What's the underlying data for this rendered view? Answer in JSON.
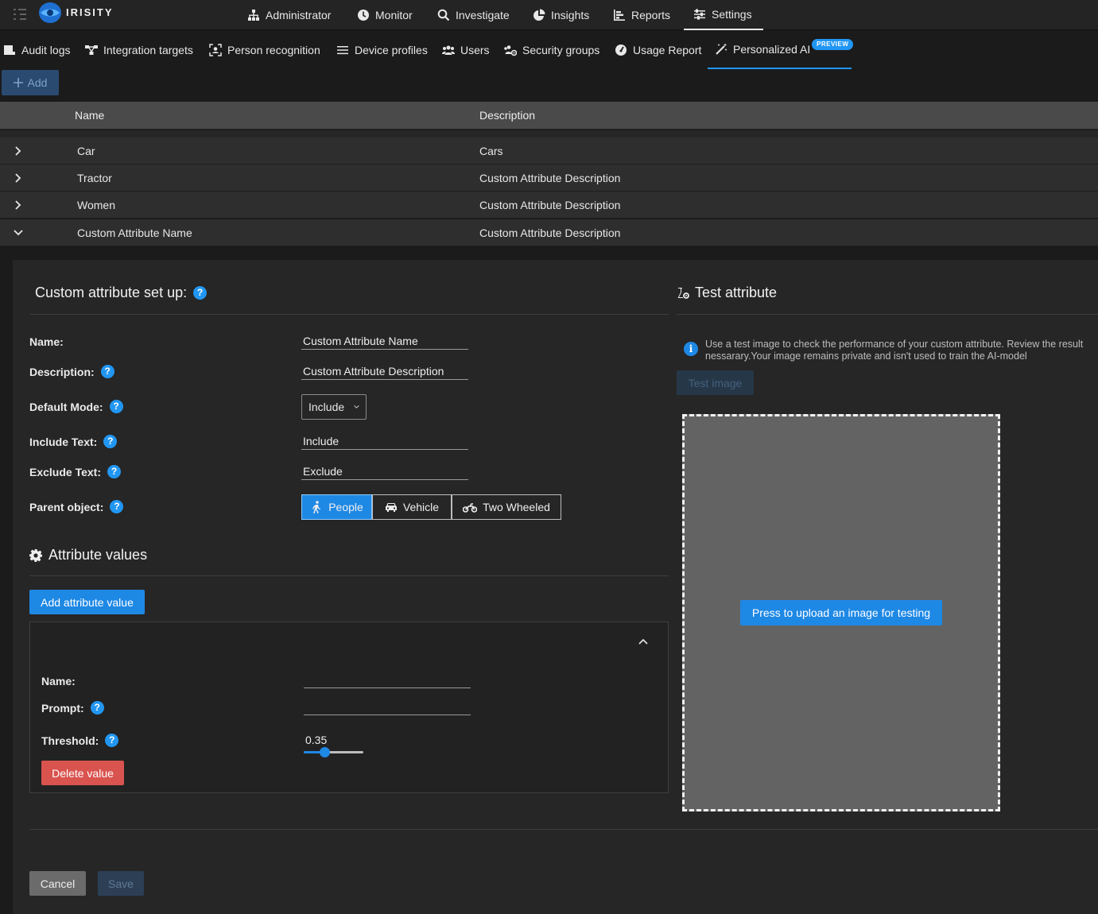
{
  "topnav": {
    "brand": "IRISITY",
    "items": [
      {
        "label": "Administrator",
        "icon": "sitemap-icon"
      },
      {
        "label": "Monitor",
        "icon": "clock-icon"
      },
      {
        "label": "Investigate",
        "icon": "search-icon"
      },
      {
        "label": "Insights",
        "icon": "pie-chart-icon"
      },
      {
        "label": "Reports",
        "icon": "bar-chart-icon"
      },
      {
        "label": "Settings",
        "icon": "sliders-icon",
        "active": true
      }
    ]
  },
  "subnav": {
    "items": [
      {
        "label": "Audit logs",
        "icon": "scroll-icon"
      },
      {
        "label": "Integration targets",
        "icon": "network-icon"
      },
      {
        "label": "Person recognition",
        "icon": "face-scan-icon"
      },
      {
        "label": "Device profiles",
        "icon": "list-icon"
      },
      {
        "label": "Users",
        "icon": "users-icon"
      },
      {
        "label": "Security groups",
        "icon": "users-gear-icon"
      },
      {
        "label": "Usage Report",
        "icon": "gauge-icon"
      },
      {
        "label": "Personalized AI",
        "icon": "magic-wand-icon",
        "active": true
      }
    ],
    "badge": "PREVIEW"
  },
  "toolbar": {
    "add_label": "Add"
  },
  "table": {
    "headers": {
      "name": "Name",
      "description": "Description"
    },
    "rows": [
      {
        "name": "Car",
        "description": "Cars",
        "expanded": false
      },
      {
        "name": "Tractor",
        "description": "Custom Attribute Description",
        "expanded": false
      },
      {
        "name": "Women",
        "description": "Custom Attribute Description",
        "expanded": false
      },
      {
        "name": "Custom Attribute Name",
        "description": "Custom Attribute Description",
        "expanded": true
      }
    ]
  },
  "setup": {
    "title": "Custom attribute set up:",
    "labels": {
      "name": "Name:",
      "description": "Description:",
      "default_mode": "Default Mode:",
      "include_text": "Include Text:",
      "exclude_text": "Exclude Text:",
      "parent_object": "Parent object:"
    },
    "values": {
      "name": "Custom Attribute Name",
      "description": "Custom Attribute Description",
      "default_mode": "Include",
      "include_text": "Include",
      "exclude_text": "Exclude"
    },
    "parent_options": [
      {
        "label": "People",
        "icon": "person-walking-icon",
        "selected": true
      },
      {
        "label": "Vehicle",
        "icon": "car-icon",
        "selected": false
      },
      {
        "label": "Two Wheeled",
        "icon": "motorcycle-icon",
        "selected": false
      }
    ]
  },
  "attribute_values": {
    "title": "Attribute values",
    "add_label": "Add attribute value",
    "labels": {
      "name": "Name:",
      "prompt": "Prompt:",
      "threshold": "Threshold:"
    },
    "values": {
      "name": "",
      "prompt": "",
      "threshold": "0.35"
    },
    "threshold_fraction": 0.35,
    "delete_label": "Delete value"
  },
  "test": {
    "title": "Test attribute",
    "info": "Use a test image to check the performance of your custom attribute. Review the result nessarary.Your image remains private and isn't used to train the AI-model",
    "test_button": "Test image",
    "upload_button": "Press to upload an image for testing"
  },
  "footer": {
    "cancel": "Cancel",
    "save": "Save"
  },
  "colors": {
    "accent": "#1e88e5",
    "danger": "#d9534f",
    "background": "#1b1b1b",
    "panel": "#262626"
  }
}
